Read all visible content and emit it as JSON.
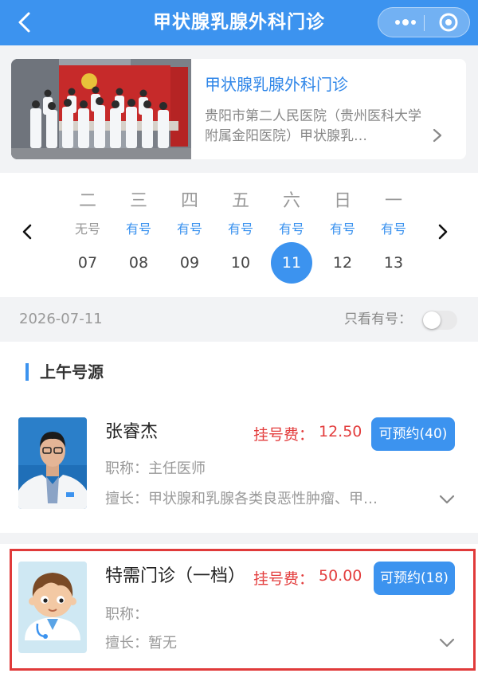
{
  "nav": {
    "title": "甲状腺乳腺外科门诊"
  },
  "dept_card": {
    "name": "甲状腺乳腺外科门诊",
    "hospital": "贵阳市第二人民医院（贵州医科大学附属金阳医院）甲状腺乳…"
  },
  "days": [
    {
      "weekday": "二",
      "status": "无号",
      "date": "07",
      "available": false,
      "selected": false
    },
    {
      "weekday": "三",
      "status": "有号",
      "date": "08",
      "available": true,
      "selected": false
    },
    {
      "weekday": "四",
      "status": "有号",
      "date": "09",
      "available": true,
      "selected": false
    },
    {
      "weekday": "五",
      "status": "有号",
      "date": "10",
      "available": true,
      "selected": false
    },
    {
      "weekday": "六",
      "status": "有号",
      "date": "11",
      "available": true,
      "selected": true
    },
    {
      "weekday": "日",
      "status": "有号",
      "date": "12",
      "available": true,
      "selected": false
    },
    {
      "weekday": "一",
      "status": "有号",
      "date": "13",
      "available": true,
      "selected": false
    }
  ],
  "filter": {
    "date": "2026-07-11",
    "only_available_label": "只看有号：",
    "only_available_on": false
  },
  "section": {
    "title": "上午号源"
  },
  "doctors": [
    {
      "name": "张睿杰",
      "fee_label": "挂号费：",
      "fee": "12.50",
      "book_label": "可预约(40)",
      "title_label": "职称：",
      "title": "主任医师",
      "specialty_label": "擅长：",
      "specialty": "甲状腺和乳腺各类良恶性肿瘤、甲…"
    },
    {
      "name": "特需门诊（一档）",
      "fee_label": "挂号费：",
      "fee": "50.00",
      "book_label": "可预约(18)",
      "title_label": "职称：",
      "title": "",
      "specialty_label": "擅长：",
      "specialty": "暂无"
    }
  ],
  "colors": {
    "primary": "#3c93ef",
    "fee": "#e33d3d",
    "highlight": "#e03a3a"
  }
}
